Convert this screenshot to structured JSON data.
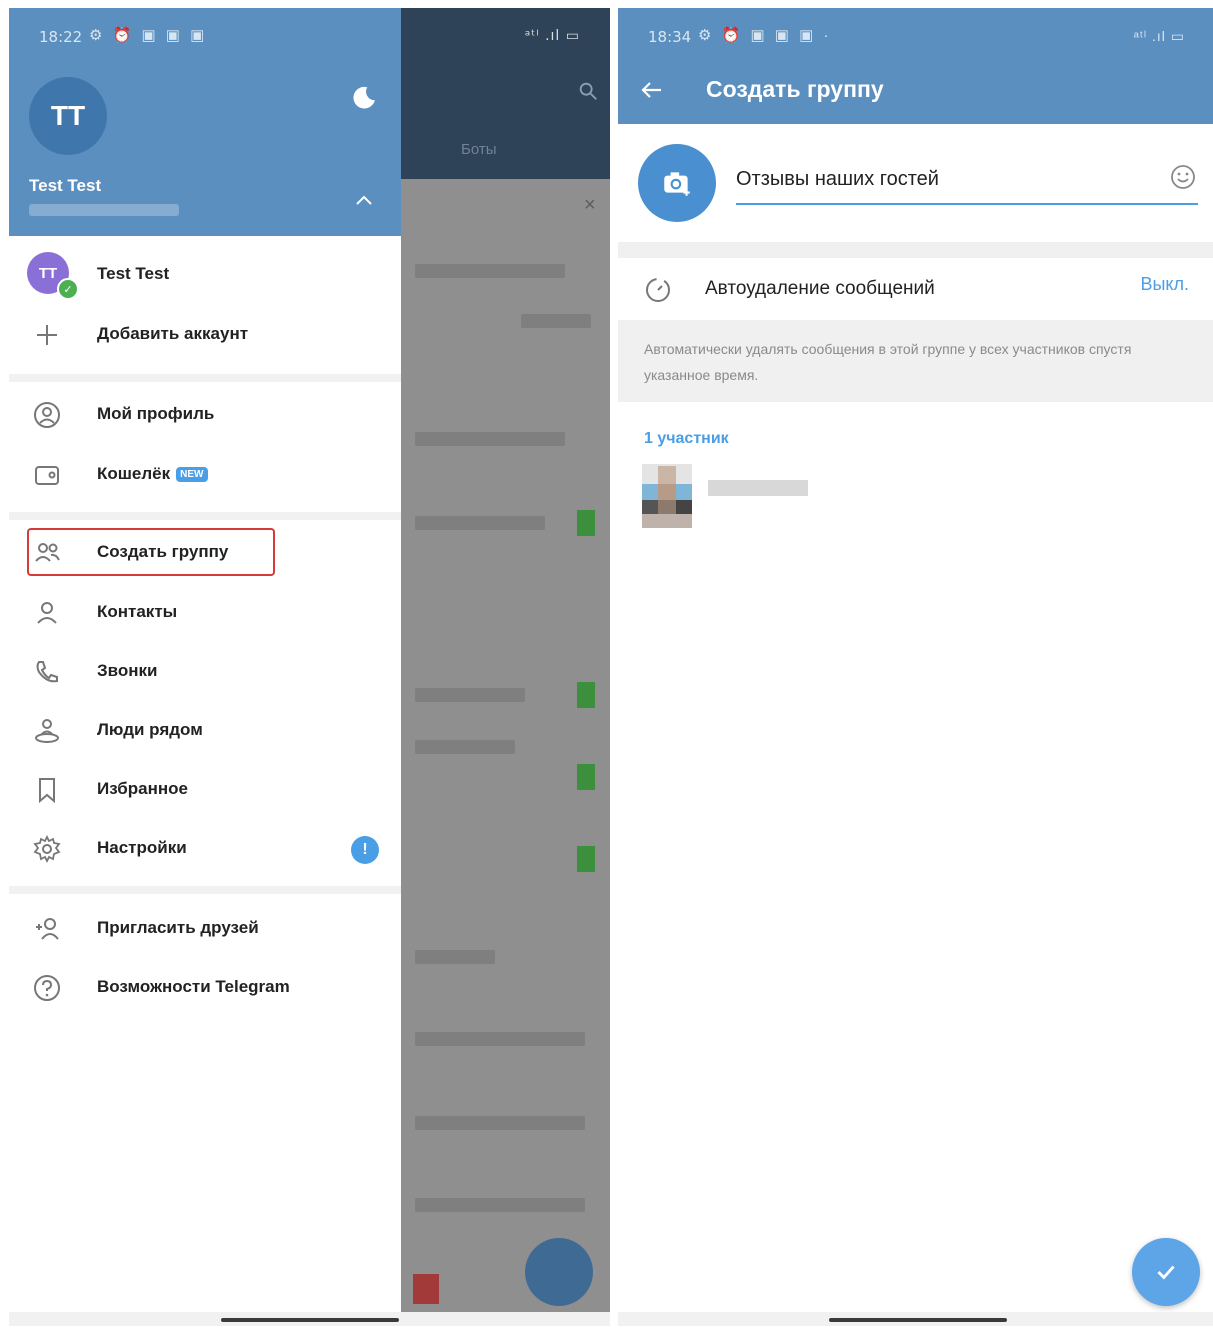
{
  "left": {
    "status_time": "18:22",
    "status_icons": "⚙ ⏰ ▣ ▣ ▣",
    "status_signal": "ᵃᵗˡ .ıl ▭",
    "avatar_initials": "TT",
    "user_name": "Test Test",
    "accounts": [
      {
        "label": "Test Test",
        "initials": "TT"
      },
      {
        "label": "Добавить аккаунт"
      }
    ],
    "menu": {
      "my_profile": "Мой профиль",
      "wallet": "Кошелёк",
      "wallet_badge": "NEW",
      "create_group": "Создать группу",
      "contacts": "Контакты",
      "calls": "Звонки",
      "people_nearby": "Люди рядом",
      "saved": "Избранное",
      "settings": "Настройки",
      "settings_badge": "!",
      "invite": "Пригласить друзей",
      "features": "Возможности Telegram"
    },
    "background": {
      "tab_label": "Боты",
      "close_symbol": "×"
    }
  },
  "right": {
    "status_time": "18:34",
    "status_icons": "⚙ ⏰ ▣ ▣ ▣ ·",
    "status_signal": "ᵃᵗˡ .ıl ▭",
    "title": "Создать группу",
    "group_name": "Отзывы наших гостей",
    "auto_delete_label": "Автоудаление сообщений",
    "auto_delete_value": "Выкл.",
    "auto_delete_description": "Автоматически удалять сообщения в этой группе у всех участников спустя указанное время.",
    "members_title": "1 участник"
  },
  "colors": {
    "header": "#5b8fbf",
    "accent": "#4a9ee6",
    "highlight": "#d83a3a"
  },
  "icons": [
    "moon-icon",
    "chevron-up-icon",
    "plus-icon",
    "profile-icon",
    "wallet-icon",
    "group-icon",
    "contact-icon",
    "phone-icon",
    "nearby-icon",
    "bookmark-icon",
    "gear-icon",
    "add-friend-icon",
    "help-icon",
    "back-arrow-icon",
    "camera-icon",
    "smile-icon",
    "timer-icon",
    "check-icon",
    "search-icon",
    "pencil-icon"
  ]
}
